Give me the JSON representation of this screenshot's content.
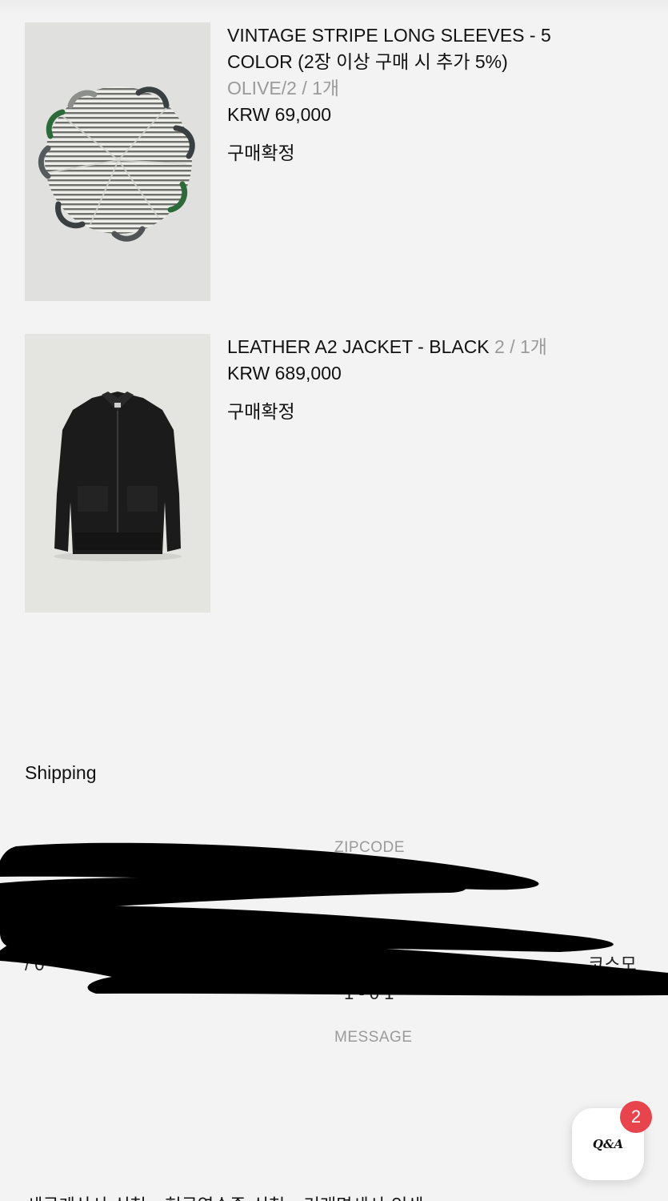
{
  "order_items": [
    {
      "name": "VINTAGE STRIPE LONG SLEEVES - 5 COLOR (2장 이상 구매 시 추가 5%)",
      "option": "OLIVE/2 / 1개",
      "price": "KRW 69,000",
      "status": "구매확정",
      "image": "striped-tees-circle-photo"
    },
    {
      "name": "LEATHER A2 JACKET - BLACK",
      "option": "2 / 1개",
      "price": "KRW 689,000",
      "status": "구매확정",
      "image": "black-leather-jacket-photo"
    }
  ],
  "shipping": {
    "title": "Shipping",
    "zipcode_label": "ZIPCODE",
    "message_label": "MESSAGE",
    "partial_left": "/ 0",
    "partial_right": "코스모",
    "partial_center": "1 - 0 1"
  },
  "qa_widget": {
    "label": "Q&A",
    "badge_count": "2"
  },
  "bottom_links": "세금계산서 신청 · 현금영수증 신청 · 거래명세서 인쇄"
}
